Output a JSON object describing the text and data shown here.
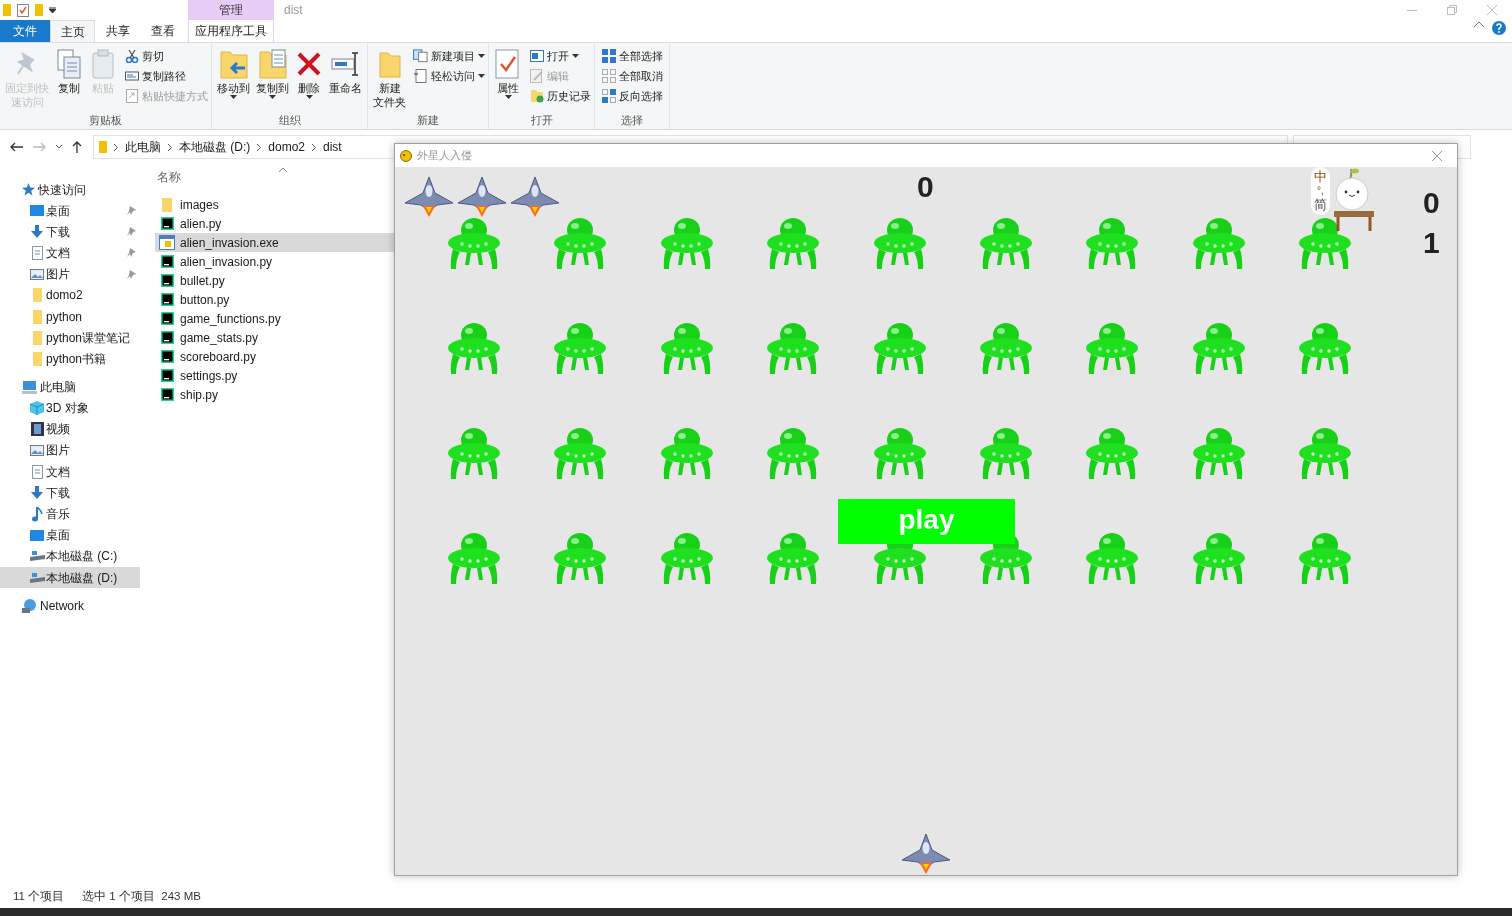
{
  "title_bar": {
    "context_header": "管理",
    "title": "dist"
  },
  "tabs": [
    {
      "label": "文件",
      "kind": "file",
      "selected": false
    },
    {
      "label": "主页",
      "kind": "normal",
      "selected": true
    },
    {
      "label": "共享",
      "kind": "normal",
      "selected": false
    },
    {
      "label": "查看",
      "kind": "normal",
      "selected": false
    },
    {
      "label": "应用程序工具",
      "kind": "context",
      "selected": false
    }
  ],
  "ribbon": [
    {
      "label": "剪贴板",
      "items": [
        {
          "kind": "large",
          "lines": [
            "固定到快",
            "速访问"
          ],
          "disabled": true,
          "dropdown": false
        },
        {
          "kind": "large",
          "lines": [
            "复制"
          ],
          "disabled": false,
          "dropdown": false
        },
        {
          "kind": "large",
          "lines": [
            "粘贴"
          ],
          "disabled": true,
          "dropdown": false
        },
        {
          "kind": "stack",
          "entries": [
            {
              "label": "剪切",
              "disabled": false,
              "dropdown": false
            },
            {
              "label": "复制路径",
              "disabled": false,
              "dropdown": false
            },
            {
              "label": "粘贴快捷方式",
              "disabled": true,
              "dropdown": false
            }
          ]
        }
      ]
    },
    {
      "label": "组织",
      "items": [
        {
          "kind": "large",
          "lines": [
            "移动到"
          ],
          "disabled": false,
          "dropdown": true
        },
        {
          "kind": "large",
          "lines": [
            "复制到"
          ],
          "disabled": false,
          "dropdown": true
        },
        {
          "kind": "large",
          "lines": [
            "删除"
          ],
          "disabled": false,
          "dropdown": true
        },
        {
          "kind": "large",
          "lines": [
            "重命名"
          ],
          "disabled": false,
          "dropdown": false
        }
      ]
    },
    {
      "label": "新建",
      "items": [
        {
          "kind": "large",
          "lines": [
            "新建",
            "文件夹"
          ],
          "disabled": false,
          "dropdown": false
        },
        {
          "kind": "stack",
          "entries": [
            {
              "label": "新建项目",
              "disabled": false,
              "dropdown": true
            },
            {
              "label": "轻松访问",
              "disabled": false,
              "dropdown": true
            }
          ]
        }
      ]
    },
    {
      "label": "打开",
      "items": [
        {
          "kind": "large",
          "lines": [
            "属性"
          ],
          "disabled": false,
          "dropdown": true
        },
        {
          "kind": "stack",
          "entries": [
            {
              "label": "打开",
              "disabled": false,
              "dropdown": true
            },
            {
              "label": "编辑",
              "disabled": true,
              "dropdown": false
            },
            {
              "label": "历史记录",
              "disabled": false,
              "dropdown": false
            }
          ]
        }
      ]
    },
    {
      "label": "选择",
      "items": [
        {
          "kind": "stack",
          "entries": [
            {
              "label": "全部选择",
              "disabled": false,
              "dropdown": false
            },
            {
              "label": "全部取消",
              "disabled": false,
              "dropdown": false
            },
            {
              "label": "反向选择",
              "disabled": false,
              "dropdown": false
            }
          ]
        }
      ]
    }
  ],
  "address_bar": {
    "breadcrumb": [
      "此电脑",
      "本地磁盘 (D:)",
      "domo2",
      "dist"
    ]
  },
  "navigation": [
    {
      "label": "快速访问",
      "kind": "star",
      "selected": false,
      "children": [
        {
          "label": "桌面",
          "kind": "desktop",
          "pinned": true,
          "selected": false
        },
        {
          "label": "下载",
          "kind": "download",
          "pinned": true,
          "selected": false
        },
        {
          "label": "文档",
          "kind": "document",
          "pinned": true,
          "selected": false
        },
        {
          "label": "图片",
          "kind": "pictures",
          "pinned": true,
          "selected": false
        },
        {
          "label": "domo2",
          "kind": "folder",
          "pinned": false,
          "selected": false
        },
        {
          "label": "python",
          "kind": "folder",
          "pinned": false,
          "selected": false
        },
        {
          "label": "python课堂笔记",
          "kind": "folder",
          "pinned": false,
          "selected": false
        },
        {
          "label": "python书籍",
          "kind": "folder",
          "pinned": false,
          "selected": false
        }
      ]
    },
    {
      "label": "此电脑",
      "kind": "pc",
      "selected": false,
      "children": [
        {
          "label": "3D 对象",
          "kind": "cube",
          "pinned": false,
          "selected": false
        },
        {
          "label": "视频",
          "kind": "video",
          "pinned": false,
          "selected": false
        },
        {
          "label": "图片",
          "kind": "pictures",
          "pinned": false,
          "selected": false
        },
        {
          "label": "文档",
          "kind": "document",
          "pinned": false,
          "selected": false
        },
        {
          "label": "下载",
          "kind": "download",
          "pinned": false,
          "selected": false
        },
        {
          "label": "音乐",
          "kind": "music",
          "pinned": false,
          "selected": false
        },
        {
          "label": "桌面",
          "kind": "desktop",
          "pinned": false,
          "selected": false
        },
        {
          "label": "本地磁盘 (C:)",
          "kind": "drive",
          "pinned": false,
          "selected": false
        },
        {
          "label": "本地磁盘 (D:)",
          "kind": "drive",
          "pinned": false,
          "selected": true
        }
      ]
    },
    {
      "label": "Network",
      "kind": "network",
      "selected": false
    }
  ],
  "file_list": {
    "column": "名称",
    "files": [
      {
        "name": "images",
        "kind": "folder",
        "selected": false
      },
      {
        "name": "alien.py",
        "kind": "py",
        "selected": false
      },
      {
        "name": "alien_invasion.exe",
        "kind": "exe",
        "selected": true
      },
      {
        "name": "alien_invasion.py",
        "kind": "py",
        "selected": false
      },
      {
        "name": "bullet.py",
        "kind": "py",
        "selected": false
      },
      {
        "name": "button.py",
        "kind": "py",
        "selected": false
      },
      {
        "name": "game_functions.py",
        "kind": "py",
        "selected": false
      },
      {
        "name": "game_stats.py",
        "kind": "py",
        "selected": false
      },
      {
        "name": "scoreboard.py",
        "kind": "py",
        "selected": false
      },
      {
        "name": "settings.py",
        "kind": "py",
        "selected": false
      },
      {
        "name": "ship.py",
        "kind": "py",
        "selected": false
      }
    ]
  },
  "status_bar": {
    "item_count": "11 个项目",
    "selection": "选中 1 个项目  243 MB"
  },
  "game_window": {
    "title": "外星人入侵",
    "score": "0",
    "high_score": "0",
    "level": "1",
    "lives": [
      {
        "kind": "ship"
      },
      {
        "kind": "ship"
      },
      {
        "kind": "ship"
      }
    ],
    "alien_rows": [
      [
        {
          "kind": "alien"
        },
        {
          "kind": "alien"
        },
        {
          "kind": "alien"
        },
        {
          "kind": "alien"
        },
        {
          "kind": "alien"
        },
        {
          "kind": "alien"
        },
        {
          "kind": "alien"
        },
        {
          "kind": "alien"
        },
        {
          "kind": "alien"
        }
      ],
      [
        {
          "kind": "alien"
        },
        {
          "kind": "alien"
        },
        {
          "kind": "alien"
        },
        {
          "kind": "alien"
        },
        {
          "kind": "alien"
        },
        {
          "kind": "alien"
        },
        {
          "kind": "alien"
        },
        {
          "kind": "alien"
        },
        {
          "kind": "alien"
        }
      ],
      [
        {
          "kind": "alien"
        },
        {
          "kind": "alien"
        },
        {
          "kind": "alien"
        },
        {
          "kind": "alien"
        },
        {
          "kind": "alien"
        },
        {
          "kind": "alien"
        },
        {
          "kind": "alien"
        },
        {
          "kind": "alien"
        },
        {
          "kind": "alien"
        }
      ],
      [
        {
          "kind": "alien"
        },
        {
          "kind": "alien"
        },
        {
          "kind": "alien"
        },
        {
          "kind": "alien"
        },
        {
          "kind": "alien"
        },
        {
          "kind": "alien"
        },
        {
          "kind": "alien"
        },
        {
          "kind": "alien"
        },
        {
          "kind": "alien"
        }
      ]
    ],
    "play_button": "play"
  },
  "ime_indicator": {
    "mode": "中",
    "punctuation": "°,",
    "script": "简"
  }
}
